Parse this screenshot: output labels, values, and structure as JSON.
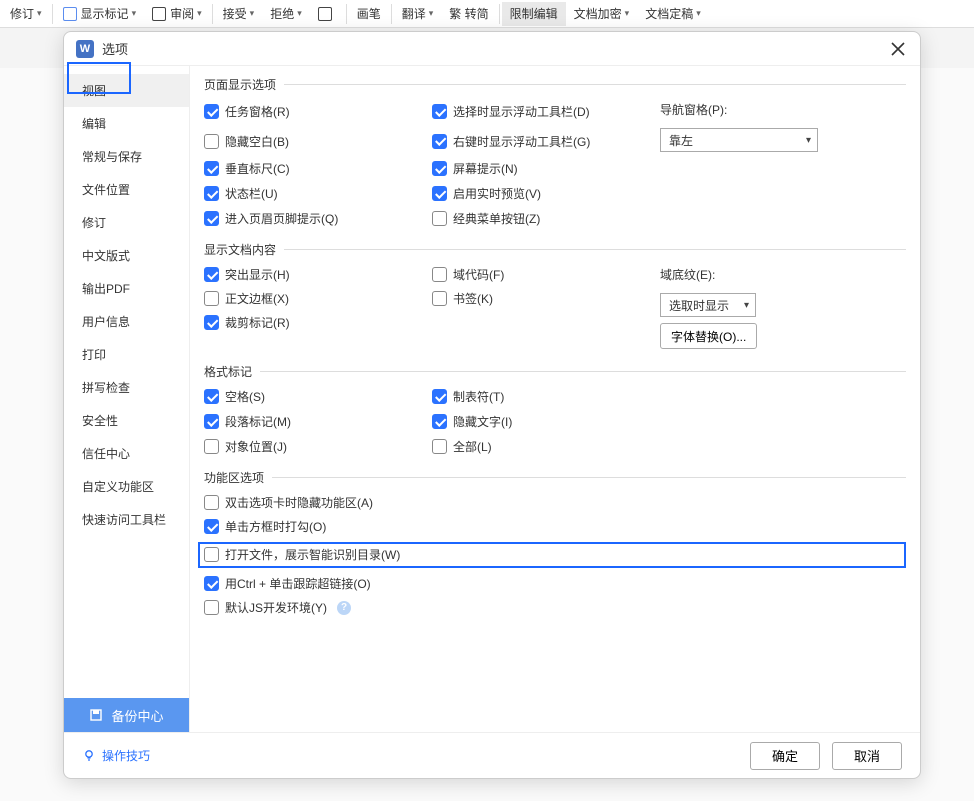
{
  "toolbar": {
    "revise": "修订",
    "showmarks": "显示标记",
    "review": "审阅",
    "accept": "接受",
    "reject": "拒绝",
    "pen": "画笔",
    "translate": "翻译",
    "tradconv": "繁  转简",
    "restrictEdit": "限制编辑",
    "docEncrypt": "文档加密",
    "docFinal": "文档定稿"
  },
  "dialog": {
    "title": "选项",
    "ok": "确定",
    "cancel": "取消",
    "tips": "操作技巧"
  },
  "sidebar": {
    "items": [
      "视图",
      "编辑",
      "常规与保存",
      "文件位置",
      "修订",
      "中文版式",
      "输出PDF",
      "用户信息",
      "打印",
      "拼写检查",
      "安全性",
      "信任中心",
      "自定义功能区",
      "快速访问工具栏"
    ],
    "backup": "备份中心"
  },
  "sections": {
    "pageDisplay": {
      "legend": "页面显示选项",
      "taskPane": "任务窗格(R)",
      "hideBlank": "隐藏空白(B)",
      "vRuler": "垂直标尺(C)",
      "statusBar": "状态栏(U)",
      "headerFooterHint": "进入页眉页脚提示(Q)",
      "selFloatToolbar": "选择时显示浮动工具栏(D)",
      "rclickFloatToolbar": "右键时显示浮动工具栏(G)",
      "screenTip": "屏幕提示(N)",
      "livePreview": "启用实时预览(V)",
      "classicMenu": "经典菜单按钮(Z)",
      "navPane": "导航窗格(P):",
      "navSelected": "靠左"
    },
    "docContent": {
      "legend": "显示文档内容",
      "highlight": "突出显示(H)",
      "textBoundary": "正文边框(X)",
      "cropMarks": "裁剪标记(R)",
      "fieldCodes": "域代码(F)",
      "bookmarks": "书签(K)",
      "fieldShading": "域底纹(E):",
      "fieldShadingSel": "选取时显示",
      "fontSub": "字体替换(O)..."
    },
    "formatMarks": {
      "legend": "格式标记",
      "spaces": "空格(S)",
      "paragraph": "段落标记(M)",
      "objAnchor": "对象位置(J)",
      "tab": "制表符(T)",
      "hiddenText": "隐藏文字(I)",
      "all": "全部(L)"
    },
    "ribbon": {
      "legend": "功能区选项",
      "dblclickHide": "双击选项卡时隐藏功能区(A)",
      "clickBoxCheck": "单击方框时打勾(O)",
      "openShowToc": "打开文件，展示智能识别目录(W)",
      "ctrlClickHyperlink": "用Ctrl + 单击跟踪超链接(O)",
      "defaultJsDev": "默认JS开发环境(Y)"
    }
  }
}
